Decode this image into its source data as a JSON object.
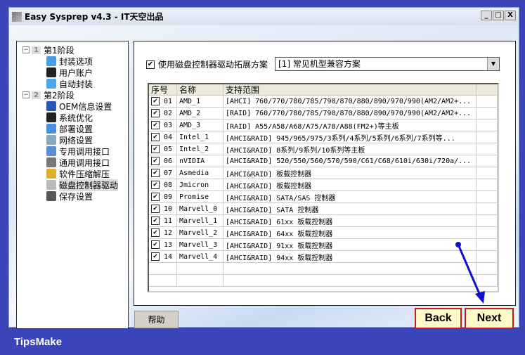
{
  "window": {
    "title": "Easy Sysprep v4.3 - IT天空出品",
    "minimize": "_",
    "maximize": "□",
    "close": "X"
  },
  "tree": [
    {
      "label": "第1阶段",
      "num": "1",
      "level": 0,
      "icon": "stage-icon",
      "expander": "−"
    },
    {
      "label": "封装选项",
      "level": 1,
      "icon": "monitor-icon",
      "color": "#4a9de0"
    },
    {
      "label": "用户账户",
      "level": 1,
      "icon": "user-icon",
      "color": "#222"
    },
    {
      "label": "自动封装",
      "level": 1,
      "icon": "arrow-right-icon",
      "color": "#4aa8e8"
    },
    {
      "label": "第2阶段",
      "num": "2",
      "level": 0,
      "icon": "stage-icon",
      "expander": "−"
    },
    {
      "label": "OEM信息设置",
      "level": 1,
      "icon": "info-icon",
      "color": "#2a55b8"
    },
    {
      "label": "系统优化",
      "level": 1,
      "icon": "gear-icon",
      "color": "#222"
    },
    {
      "label": "部署设置",
      "level": 1,
      "icon": "deploy-icon",
      "color": "#4a8fe0"
    },
    {
      "label": "网络设置",
      "level": 1,
      "icon": "network-icon",
      "color": "#8ab"
    },
    {
      "label": "专用调用接口",
      "level": 1,
      "icon": "interface-icon",
      "color": "#5a8fd0"
    },
    {
      "label": "通用调用接口",
      "level": 1,
      "icon": "interface-icon",
      "color": "#777"
    },
    {
      "label": "软件压缩解压",
      "level": 1,
      "icon": "archive-icon",
      "color": "#e0b030"
    },
    {
      "label": "磁盘控制器驱动",
      "level": 1,
      "icon": "disk-icon",
      "color": "#bbb",
      "selected": true
    },
    {
      "label": "保存设置",
      "level": 1,
      "icon": "save-icon",
      "color": "#555"
    }
  ],
  "main": {
    "use_ext_label": "使用磁盘控制器驱动拓展方案",
    "use_ext_checked": "✔",
    "scheme_value": "[1] 常见机型兼容方案",
    "dropdown_arrow": "▼",
    "headers": [
      "序号",
      "名称",
      "支持范围"
    ],
    "rows": [
      [
        "01",
        "AMD_1",
        "[AHCI] 760/770/780/785/790/870/880/890/970/990(AM2/AM2+..."
      ],
      [
        "02",
        "AMD_2",
        "[RAID] 760/770/780/785/790/870/880/890/970/990(AM2/AM2+..."
      ],
      [
        "03",
        "AMD_3",
        "[RAID] A55/A58/A68/A75/A78/A88(FM2+)等主板"
      ],
      [
        "04",
        "Intel_1",
        "[AHCI&RAID] 945/965/975/3系列/4系列/5系列/6系列/7系列等..."
      ],
      [
        "05",
        "Intel_2",
        "[AHCI&RAID] 8系列/9系列/10系列等主板"
      ],
      [
        "06",
        "nVIDIA",
        "[AHCI&RAID] 520/550/560/570/590/C61/C68/610i/630i/720a/..."
      ],
      [
        "07",
        "Asmedia",
        "[AHCI&RAID] 板载控制器"
      ],
      [
        "08",
        "Jmicron",
        "[AHCI&RAID] 板载控制器"
      ],
      [
        "09",
        "Promise",
        "[AHCI&RAID] SATA/SAS 控制器"
      ],
      [
        "10",
        "Marvell_0",
        "[AHCI&RAID] SATA 控制器"
      ],
      [
        "11",
        "Marvell_1",
        "[AHCI&RAID] 61xx 板载控制器"
      ],
      [
        "12",
        "Marvell_2",
        "[AHCI&RAID] 64xx 板载控制器"
      ],
      [
        "13",
        "Marvell_3",
        "[AHCI&RAID] 91xx 板载控制器"
      ],
      [
        "14",
        "Marvell_4",
        "[AHCI&RAID] 94xx 板载控制器"
      ]
    ],
    "check_mark": "✔"
  },
  "buttons": {
    "help": "帮助",
    "back": "Back",
    "next": "Next"
  },
  "brand": "TipsMake",
  "annotation_color": "#1010d0"
}
